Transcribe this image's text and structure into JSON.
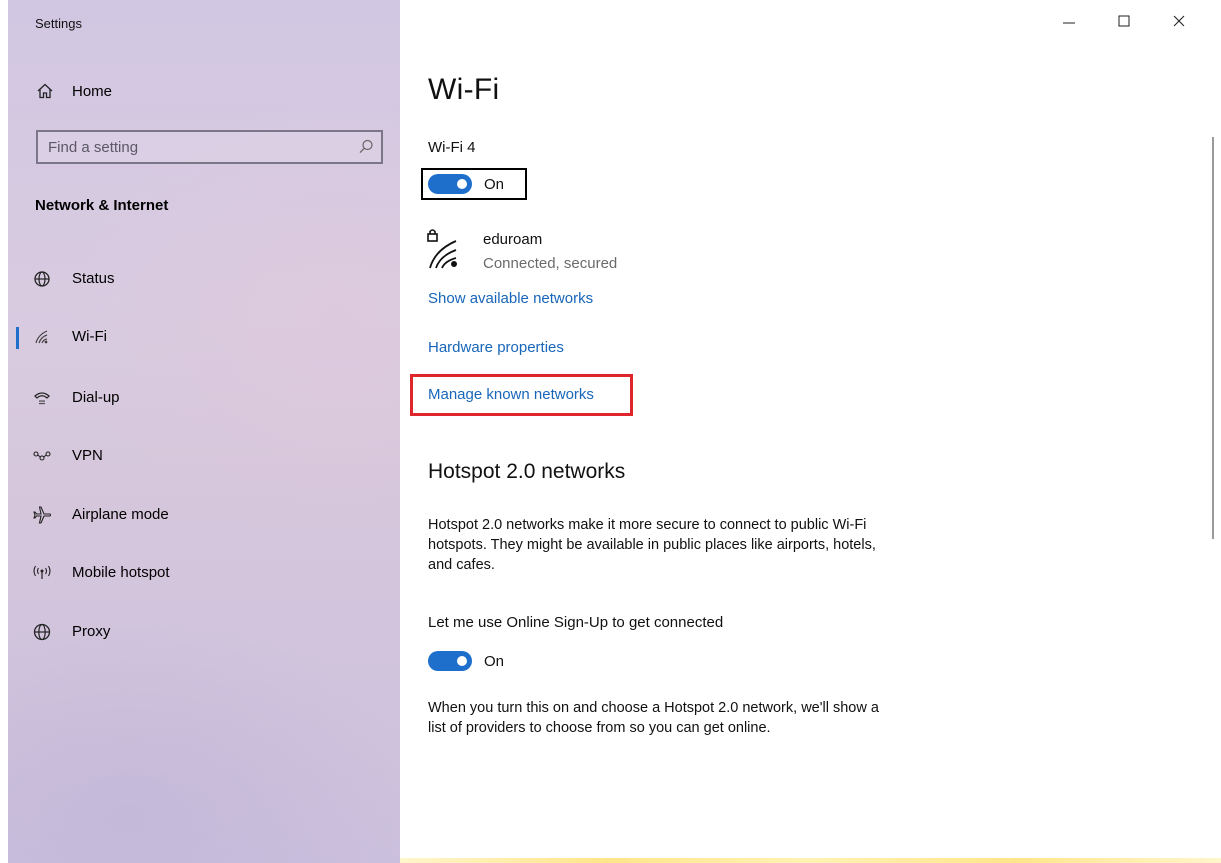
{
  "window": {
    "title": "Settings",
    "controls": {
      "minimize": "minimize-icon",
      "maximize": "maximize-icon",
      "close": "close-icon"
    }
  },
  "sidebar": {
    "home_label": "Home",
    "search_placeholder": "Find a setting",
    "section_title": "Network & Internet",
    "items": [
      {
        "label": "Status",
        "icon": "globe-status-icon"
      },
      {
        "label": "Wi-Fi",
        "icon": "wifi-icon",
        "active": true
      },
      {
        "label": "Dial-up",
        "icon": "dialup-icon"
      },
      {
        "label": "VPN",
        "icon": "vpn-icon"
      },
      {
        "label": "Airplane mode",
        "icon": "airplane-icon"
      },
      {
        "label": "Mobile hotspot",
        "icon": "hotspot-icon"
      },
      {
        "label": "Proxy",
        "icon": "globe-icon"
      }
    ]
  },
  "main": {
    "title": "Wi-Fi",
    "adapter_label": "Wi-Fi 4",
    "wifi_toggle": {
      "state": "On",
      "on": true
    },
    "network": {
      "name": "eduroam",
      "status": "Connected, secured"
    },
    "links": {
      "show_available": "Show available networks",
      "hardware_properties": "Hardware properties",
      "manage_known": "Manage known networks"
    },
    "hotspot": {
      "heading": "Hotspot 2.0 networks",
      "description_line1": "Hotspot 2.0 networks make it more secure to connect to public Wi-Fi",
      "description_line2": "hotspots. They might be available in public places like airports, hotels,",
      "description_line3": "and cafes.",
      "signup_label": "Let me use Online Sign-Up to get connected",
      "signup_toggle": {
        "state": "On",
        "on": true
      },
      "note_line1": "When you turn this on and choose a Hotspot 2.0 network, we'll show a",
      "note_line2": "list of providers to choose from so you can get online."
    }
  },
  "colors": {
    "accent": "#1e6fcc",
    "link": "#1866b9",
    "highlight": "#e0262d"
  }
}
